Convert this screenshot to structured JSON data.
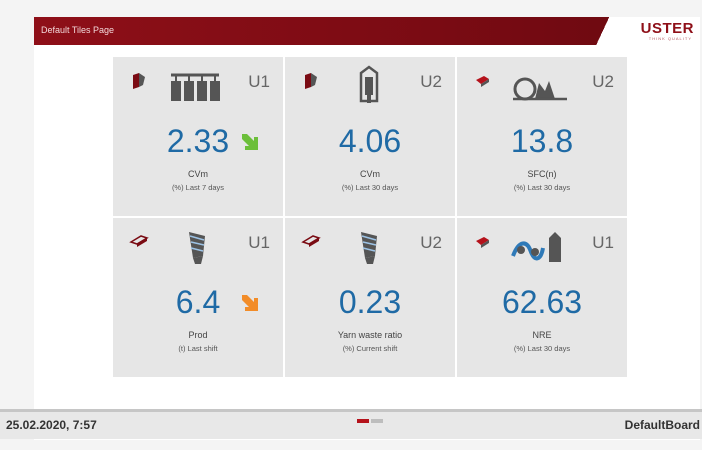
{
  "header": {
    "title": "Default Tiles Page",
    "logo": "USTER",
    "logo_sub": "THINK QUALITY"
  },
  "colors": {
    "brand": "#8e0f18",
    "value": "#1f6aa5",
    "up": "#6cbf3a",
    "down": "#f28c28"
  },
  "tiles": [
    {
      "unit": "U1",
      "value": "2.33",
      "label": "CVm",
      "sublabel": "(%) Last 7 days",
      "trend": "down-right-green",
      "icon": "yarn-bobbins-icon"
    },
    {
      "unit": "U2",
      "value": "4.06",
      "label": "CVm",
      "sublabel": "(%) Last 30 days",
      "trend": "",
      "icon": "bobbin-icon"
    },
    {
      "unit": "U2",
      "value": "13.8",
      "label": "SFC(n)",
      "sublabel": "(%) Last 30 days",
      "trend": "",
      "icon": "fiber-roll-icon"
    },
    {
      "unit": "U1",
      "value": "6.4",
      "label": "Prod",
      "sublabel": "(t) Last shift",
      "trend": "down-right-orange",
      "icon": "cone-icon"
    },
    {
      "unit": "U2",
      "value": "0.23",
      "label": "Yarn waste ratio",
      "sublabel": "(%) Current shift",
      "trend": "",
      "icon": "cone-icon"
    },
    {
      "unit": "U1",
      "value": "62.63",
      "label": "NRE",
      "sublabel": "(%) Last 30 days",
      "trend": "",
      "icon": "winding-icon"
    }
  ],
  "footer": {
    "datetime": "25.02.2020, 7:57",
    "board": "DefaultBoard",
    "page_index": 1,
    "page_count": 2
  }
}
